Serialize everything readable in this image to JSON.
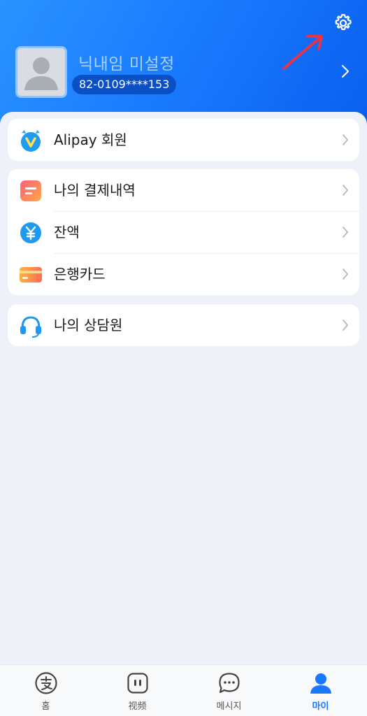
{
  "profile": {
    "nickname": "닉내임 미설정",
    "phone": "82-0109****153"
  },
  "icons": {
    "settings": "gear-icon",
    "avatar": "person-placeholder-icon",
    "chevron": "chevron-right-icon"
  },
  "menu": {
    "membership": {
      "label": "Alipay 회원",
      "icon": "vip-badge-icon"
    },
    "payment_history": {
      "label": "나의 결제내역",
      "icon": "bill-icon"
    },
    "balance": {
      "label": "잔액",
      "icon": "yuan-coin-icon"
    },
    "bank_card": {
      "label": "은행카드",
      "icon": "card-icon"
    },
    "support": {
      "label": "나의 상담원",
      "icon": "headset-icon"
    }
  },
  "tabbar": {
    "items": [
      {
        "label": "홈",
        "icon": "alipay-logo-icon",
        "active": false
      },
      {
        "label": "视频",
        "icon": "video-icon",
        "active": false
      },
      {
        "label": "메시지",
        "icon": "chat-bubble-icon",
        "active": false
      },
      {
        "label": "마이",
        "icon": "person-icon",
        "active": true
      }
    ]
  },
  "colors": {
    "header_gradient_start": "#2a93ff",
    "header_gradient_end": "#0a5ff0",
    "accent": "#1a77ff",
    "annotation_arrow": "#e8334a"
  }
}
